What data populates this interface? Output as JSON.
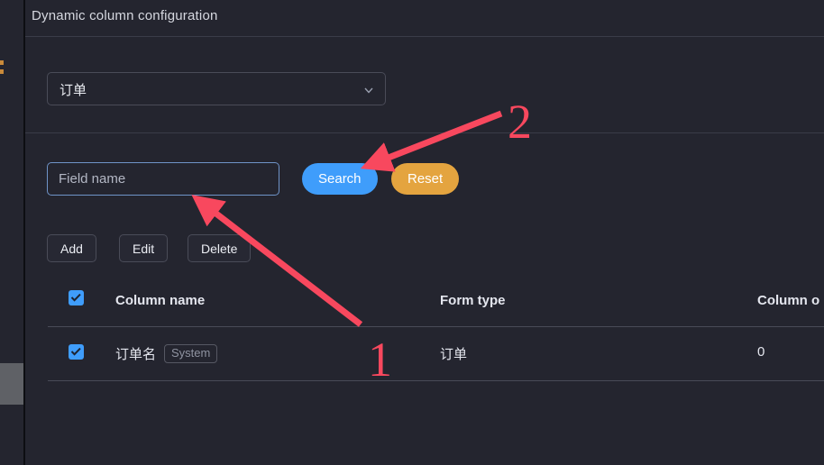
{
  "panel": {
    "title": "Dynamic column configuration"
  },
  "filter": {
    "form_select": {
      "value": "订单",
      "icon": "chevron-down-icon"
    },
    "field_name": {
      "value": "",
      "placeholder": "Field name"
    },
    "search_label": "Search",
    "reset_label": "Reset",
    "search_color": "#3f9dfb",
    "reset_color": "#e4a43f"
  },
  "actions": {
    "add_label": "Add",
    "edit_label": "Edit",
    "delete_label": "Delete"
  },
  "table": {
    "select_all_checked": true,
    "columns": [
      {
        "key": "name",
        "label": "Column name"
      },
      {
        "key": "form",
        "label": "Form type"
      },
      {
        "key": "order",
        "label": "Column o"
      }
    ],
    "rows": [
      {
        "checked": true,
        "name": "订单名",
        "tag": "System",
        "form": "订单",
        "order": "0"
      }
    ]
  },
  "annotations": {
    "accent_color": "#f8485e",
    "marker_1": "1",
    "marker_2": "2"
  }
}
